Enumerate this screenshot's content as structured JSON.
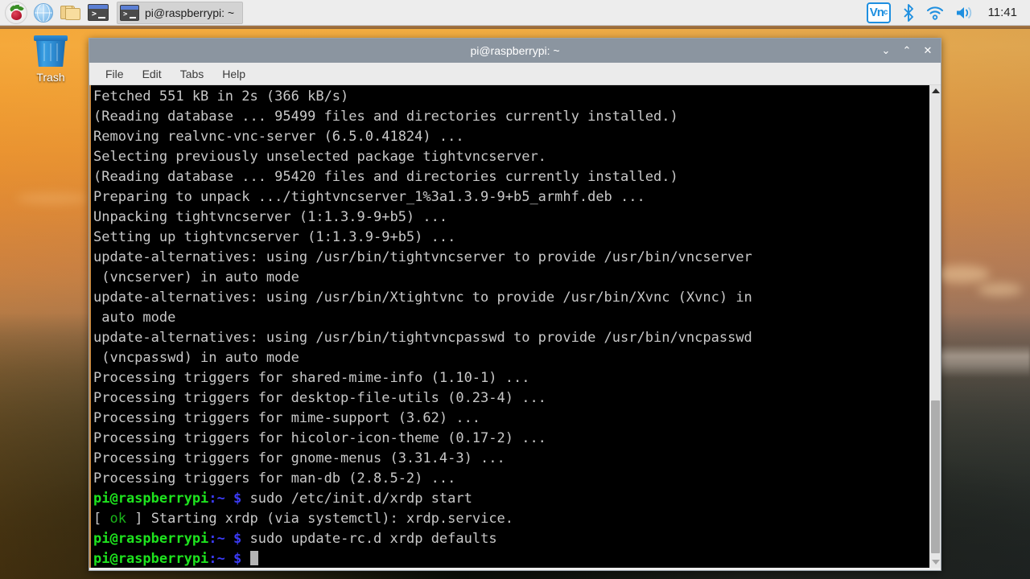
{
  "taskbar": {
    "launchers": [
      {
        "name": "raspberry-menu",
        "icon": "raspberry-icon",
        "tooltip": "Menu"
      },
      {
        "name": "web-browser",
        "icon": "globe-icon",
        "tooltip": "Web Browser"
      },
      {
        "name": "file-manager",
        "icon": "folder-icon",
        "tooltip": "File Manager"
      },
      {
        "name": "terminal",
        "icon": "terminal-icon",
        "tooltip": "Terminal"
      }
    ],
    "window_button": {
      "label": "pi@raspberrypi: ~",
      "icon": "terminal-icon"
    },
    "tray": {
      "vnc_label": "Vn",
      "vnc_sub": "c",
      "bluetooth_icon": "bluetooth-icon",
      "wifi_icon": "wifi-icon",
      "volume_icon": "volume-icon",
      "clock": "11:41"
    }
  },
  "desktop": {
    "trash_label": "Trash"
  },
  "window": {
    "title": "pi@raspberrypi: ~",
    "controls": {
      "minimize": "⌄",
      "maximize": "⌃",
      "close": "✕"
    },
    "menu": [
      {
        "label": "File"
      },
      {
        "label": "Edit"
      },
      {
        "label": "Tabs"
      },
      {
        "label": "Help"
      }
    ]
  },
  "terminal": {
    "prompt_user_host": "pi@raspberrypi",
    "prompt_path": ":~",
    "prompt_sign": "$",
    "lines": [
      {
        "type": "plain",
        "text": "Fetched 551 kB in 2s (366 kB/s)"
      },
      {
        "type": "plain",
        "text": "(Reading database ... 95499 files and directories currently installed.)"
      },
      {
        "type": "plain",
        "text": "Removing realvnc-vnc-server (6.5.0.41824) ..."
      },
      {
        "type": "plain",
        "text": "Selecting previously unselected package tightvncserver."
      },
      {
        "type": "plain",
        "text": "(Reading database ... 95420 files and directories currently installed.)"
      },
      {
        "type": "plain",
        "text": "Preparing to unpack .../tightvncserver_1%3a1.3.9-9+b5_armhf.deb ..."
      },
      {
        "type": "plain",
        "text": "Unpacking tightvncserver (1:1.3.9-9+b5) ..."
      },
      {
        "type": "plain",
        "text": "Setting up tightvncserver (1:1.3.9-9+b5) ..."
      },
      {
        "type": "plain",
        "text": "update-alternatives: using /usr/bin/tightvncserver to provide /usr/bin/vncserver"
      },
      {
        "type": "plain",
        "text": " (vncserver) in auto mode"
      },
      {
        "type": "plain",
        "text": "update-alternatives: using /usr/bin/Xtightvnc to provide /usr/bin/Xvnc (Xvnc) in"
      },
      {
        "type": "plain",
        "text": " auto mode"
      },
      {
        "type": "plain",
        "text": "update-alternatives: using /usr/bin/tightvncpasswd to provide /usr/bin/vncpasswd"
      },
      {
        "type": "plain",
        "text": " (vncpasswd) in auto mode"
      },
      {
        "type": "plain",
        "text": "Processing triggers for shared-mime-info (1.10-1) ..."
      },
      {
        "type": "plain",
        "text": "Processing triggers for desktop-file-utils (0.23-4) ..."
      },
      {
        "type": "plain",
        "text": "Processing triggers for mime-support (3.62) ..."
      },
      {
        "type": "plain",
        "text": "Processing triggers for hicolor-icon-theme (0.17-2) ..."
      },
      {
        "type": "plain",
        "text": "Processing triggers for gnome-menus (3.31.4-3) ..."
      },
      {
        "type": "plain",
        "text": "Processing triggers for man-db (2.8.5-2) ..."
      },
      {
        "type": "command",
        "command": "sudo /etc/init.d/xrdp start"
      },
      {
        "type": "status",
        "bracket_open": "[ ",
        "status": "ok",
        "bracket_close": " ] ",
        "text": "Starting xrdp (via systemctl): xrdp.service."
      },
      {
        "type": "command",
        "command": "sudo update-rc.d xrdp defaults"
      },
      {
        "type": "cursor",
        "command": ""
      }
    ]
  },
  "colors": {
    "terminal_bg": "#000000",
    "terminal_fg": "#c8c8c8",
    "prompt_green": "#1ee31e",
    "prompt_blue": "#3b3bf5",
    "status_ok_green": "#19b519",
    "titlebar": "#8b95a0",
    "panel_bg": "#ededed",
    "accent_orange": "#c88a43"
  }
}
